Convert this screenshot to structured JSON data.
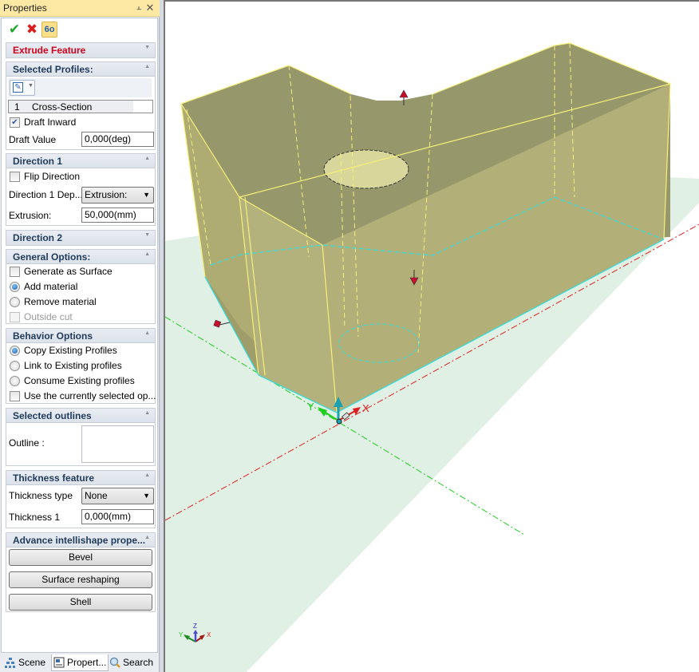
{
  "panel": {
    "title": "Properties",
    "pin_glyph": "⫠",
    "close_glyph": "✕",
    "toolbar": {
      "ok_glyph": "✔",
      "cancel_glyph": "✖",
      "preview_glyph": "6o"
    },
    "sections": {
      "extrude": {
        "title": "Extrude Feature",
        "collapsed": true
      },
      "profiles": {
        "title": "Selected Profiles:",
        "list": [
          {
            "index": "1",
            "name": "Cross-Section"
          }
        ],
        "draft_inward": {
          "label": "Draft Inward",
          "checked": true
        },
        "draft_value": {
          "label": "Draft Value",
          "value": "0,000(deg)"
        }
      },
      "direction1": {
        "title": "Direction 1",
        "flip": {
          "label": "Flip Direction",
          "checked": false
        },
        "dependency": {
          "label": "Direction 1 Dep...",
          "value": "Extrusion:"
        },
        "extrusion": {
          "label": "Extrusion:",
          "value": "50,000(mm)"
        }
      },
      "direction2": {
        "title": "Direction 2",
        "collapsed": true
      },
      "general": {
        "title": "General Options:",
        "options": [
          {
            "label": "Generate as Surface",
            "type": "checkbox",
            "checked": false
          },
          {
            "label": "Add material",
            "type": "radio",
            "checked": true
          },
          {
            "label": "Remove material",
            "type": "radio",
            "checked": false
          },
          {
            "label": "Outside cut",
            "type": "checkbox",
            "checked": false,
            "disabled": true
          }
        ]
      },
      "behavior": {
        "title": "Behavior Options",
        "options": [
          {
            "label": "Copy Existing Profiles",
            "type": "radio",
            "checked": true
          },
          {
            "label": "Link to Existing profiles",
            "type": "radio",
            "checked": false
          },
          {
            "label": "Consume Existing profiles",
            "type": "radio",
            "checked": false
          },
          {
            "label": "Use the currently selected op...",
            "type": "checkbox",
            "checked": false
          }
        ]
      },
      "outlines": {
        "title": "Selected outlines",
        "outline_label": "Outline :"
      },
      "thickness": {
        "title": "Thickness feature",
        "type": {
          "label": "Thickness type",
          "value": "None"
        },
        "thickness1": {
          "label": "Thickness 1",
          "value": "0,000(mm)"
        }
      },
      "advance": {
        "title": "Advance intellishape prope...",
        "buttons": [
          "Bevel",
          "Surface reshaping",
          "Shell"
        ]
      }
    },
    "tabs": [
      {
        "label": "Scene",
        "icon": "scene-tree-icon",
        "active": false
      },
      {
        "label": "Propert...",
        "icon": "properties-icon",
        "active": true
      },
      {
        "label": "Search",
        "icon": "magnifier-icon",
        "active": false
      }
    ]
  },
  "viewport": {
    "axis_labels": {
      "x": "X",
      "y": "Y",
      "z": "Z"
    },
    "colors": {
      "solid_top": "#96976a",
      "solid_front": "#b2af78",
      "edge": "#f5f07a",
      "profile": "#33dede",
      "ground": "#e0f0e4",
      "x_axis": "#e02020",
      "y_axis": "#22cc22",
      "z_axis": "#1aa0b0",
      "handle": "#c8102e"
    }
  }
}
